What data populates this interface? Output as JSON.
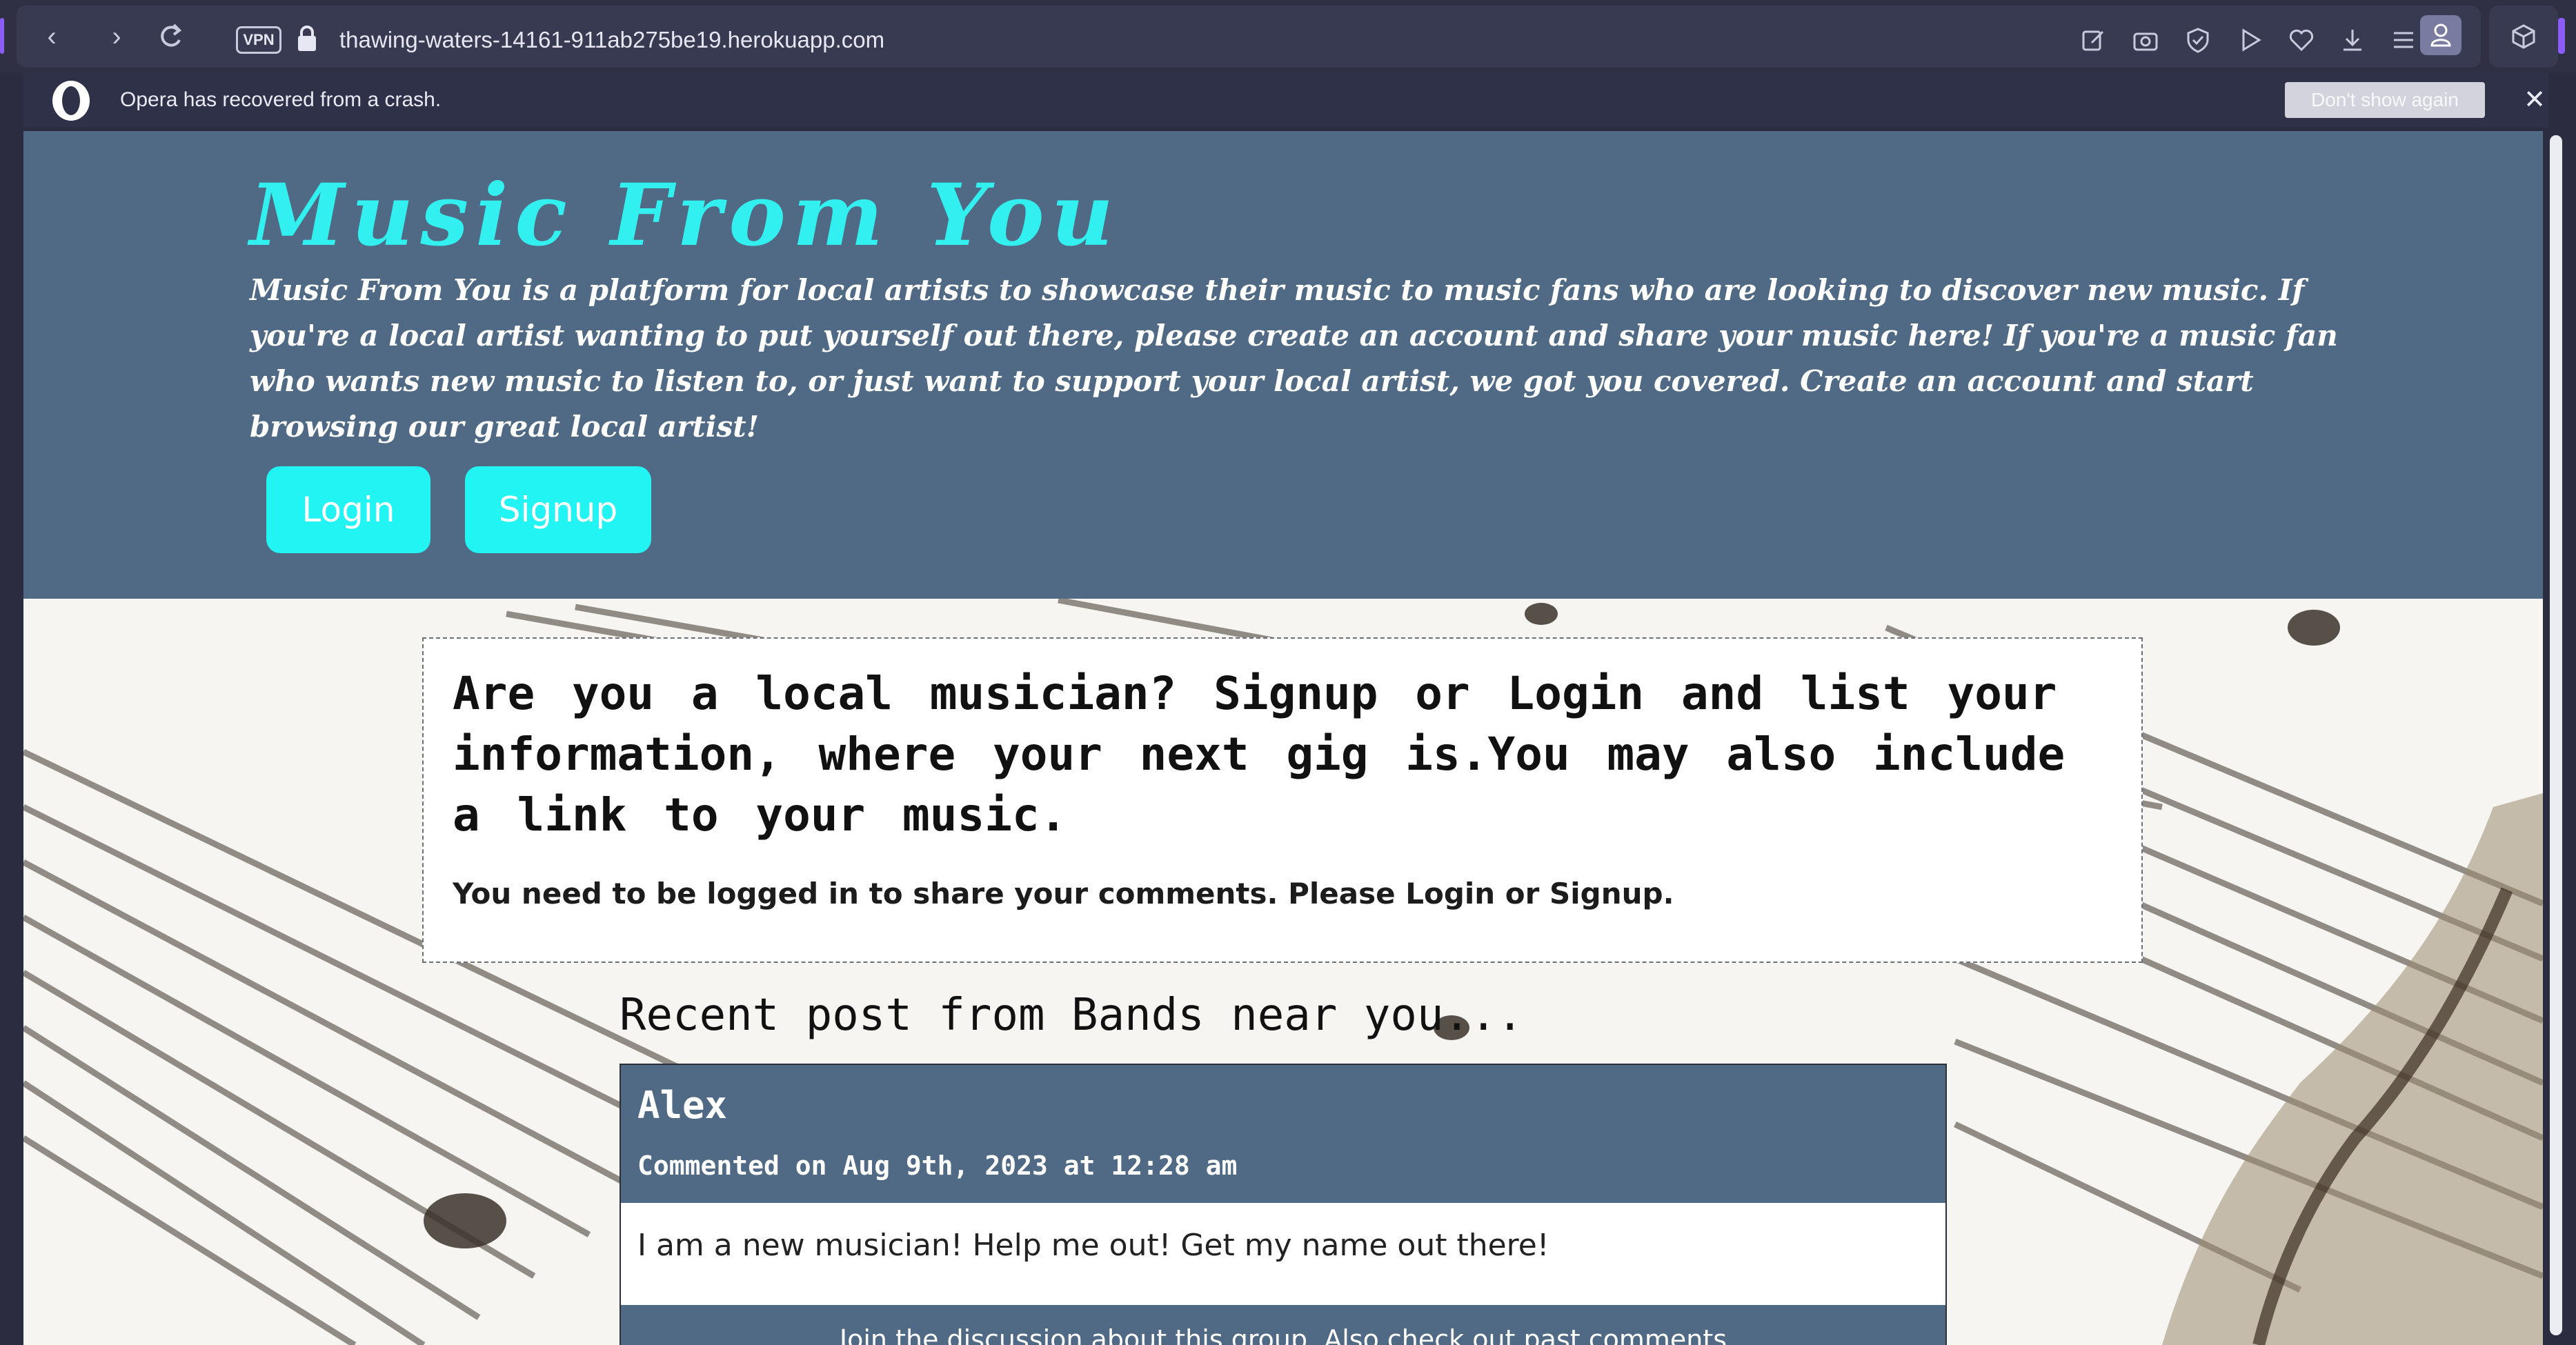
{
  "browser": {
    "vpn_label": "VPN",
    "url": "thawing-waters-14161-911ab275be19.herokuapp.com",
    "icons": [
      "back-icon",
      "forward-icon",
      "reload-icon",
      "lock-icon",
      "edit-icon",
      "camera-icon",
      "shield-icon",
      "play-icon",
      "heart-icon",
      "download-icon",
      "menu-icon",
      "profile-icon",
      "cube-icon"
    ]
  },
  "infobar": {
    "message": "Opera has recovered from a crash.",
    "dont_show_label": "Don't show again",
    "close_glyph": "✕"
  },
  "header": {
    "title": "Music From You",
    "description": "Music From You is a platform for local artists to showcase their music to music fans who are looking to discover new music. If you're a local artist wanting to put yourself out there, please create an account and share your music here! If you're a music fan who wants new music to listen to, or just want to support your local artist, we got you covered. Create an account and start browsing our great local artist!",
    "login_label": "Login",
    "signup_label": "Signup"
  },
  "info_card": {
    "heading": "Are you a local musician? Signup or Login and list your information, where your next gig is.You may also include a link to your music.",
    "note": "You need to be logged in to share your comments. Please Login or Signup."
  },
  "recent": {
    "title": "Recent post from Bands near you...",
    "posts": [
      {
        "author": "Alex",
        "date": "Commented on Aug 9th, 2023 at 12:28 am",
        "body": "I am a new musician! Help me out! Get my name out there!",
        "footer": "Join the discussion about this group. Also check out past comments"
      }
    ]
  },
  "colors": {
    "header_bg": "#506a85",
    "accent_cyan": "#33f0f0",
    "button_cyan": "#22f4f4",
    "chrome_bg": "#2f3044"
  }
}
